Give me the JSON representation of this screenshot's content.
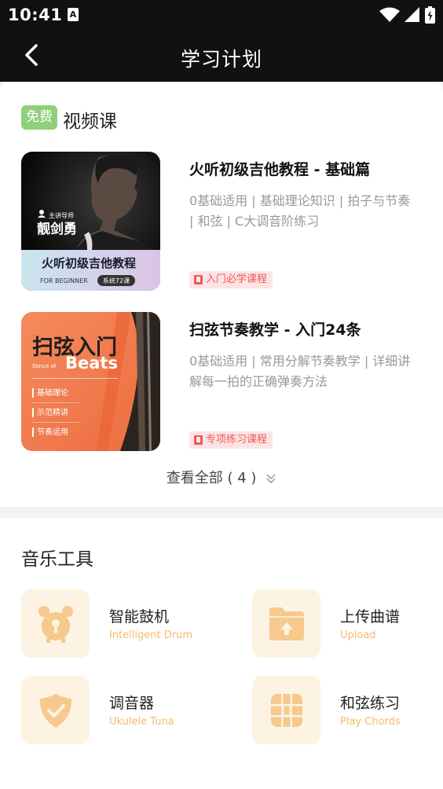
{
  "status": {
    "time": "10:41",
    "a_icon": "A"
  },
  "nav": {
    "title": "学习计划"
  },
  "video_section": {
    "badge": "免费",
    "title": "视频课",
    "courses": [
      {
        "title": "火听初级吉他教程 - 基础篇",
        "desc": "0基础适用 | 基础理论知识 | 拍子与节奏 | 和弦 | C大调音阶练习",
        "tag": "入门必学课程",
        "thumb": {
          "teacher_label": "主讲导师",
          "teacher_name": "靓剑勇",
          "course_name": "火听初级吉他教程",
          "level": "FOR BEGINNER",
          "lessons": "系统72课"
        }
      },
      {
        "title": "扫弦节奏教学 - 入门24条",
        "desc": "0基础适用 | 常用分解节奏教学 | 详细讲解每一拍的正确弹奏方法",
        "tag": "专项练习课程",
        "thumb": {
          "headline": "扫弦入门",
          "sub_small": "Sence of",
          "sub_big": "Beats",
          "items": [
            "基础理论",
            "示范精讲",
            "节奏运用"
          ]
        }
      }
    ],
    "view_all": "查看全部 ( 4 )"
  },
  "tools_section": {
    "title": "音乐工具",
    "tools": [
      {
        "name": "智能鼓机",
        "sub": "Intelligent Drum",
        "icon": "alarm-clock-icon"
      },
      {
        "name": "上传曲谱",
        "sub": "Upload",
        "icon": "folder-upload-icon"
      },
      {
        "name": "调音器",
        "sub": "Ukulele Tuna",
        "icon": "shield-check-icon"
      },
      {
        "name": "和弦练习",
        "sub": "Play Chords",
        "icon": "grid-icon"
      }
    ]
  },
  "colors": {
    "header_bg": "#111111",
    "free_badge": "#8fd07a",
    "tag_bg": "#fde4e4",
    "tag_text": "#ee5a5a",
    "tool_icon_bg": "#fdf3e3",
    "tool_icon": "#f6c98d",
    "tool_sub": "#f4b96e",
    "course2_thumb": "#f07a4f"
  }
}
